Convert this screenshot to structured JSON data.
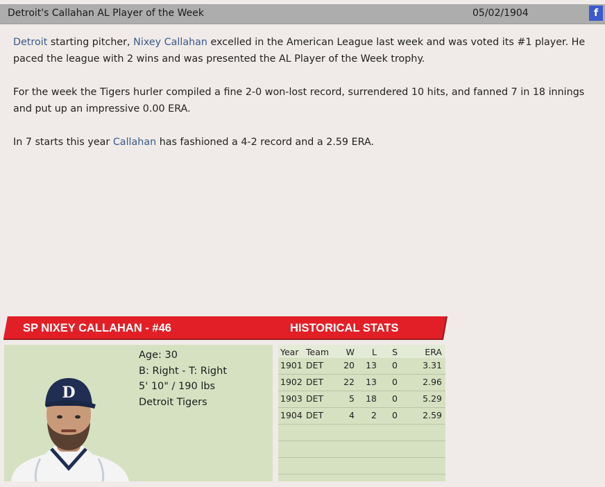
{
  "header": {
    "title": "Detroit's Callahan AL Player of the Week",
    "date": "05/02/1904",
    "share_label": "f"
  },
  "article": {
    "p1": {
      "team": "Detroit",
      "t1": " starting pitcher, ",
      "player": "Nixey Callahan",
      "t2": " excelled in the American League last week and was voted its #1 player. He paced the league with 2 wins and was presented the AL Player of the Week trophy."
    },
    "p2": "For the week the Tigers hurler compiled a fine 2-0 won-lost record, surrendered 10 hits, and fanned 7 in 18 innings and put up an impressive 0.00 ERA.",
    "p3": {
      "t1": "In 7 starts this year ",
      "player": "Callahan",
      "t2": " has fashioned a 4-2 record and a 2.59 ERA."
    }
  },
  "player_card": {
    "banner_left": "SP NIXEY CALLAHAN - #46",
    "banner_right": "HISTORICAL STATS",
    "age": "Age: 30",
    "bats_throws": "B: Right - T: Right",
    "size": "5' 10\" / 190 lbs",
    "team": "Detroit Tigers",
    "cap_logo": "D"
  },
  "stats": {
    "headers": [
      "Year",
      "Team",
      "W",
      "L",
      "S",
      "ERA"
    ],
    "rows": [
      [
        "1901",
        "DET",
        "20",
        "13",
        "0",
        "3.31"
      ],
      [
        "1902",
        "DET",
        "22",
        "13",
        "0",
        "2.96"
      ],
      [
        "1903",
        "DET",
        "5",
        "18",
        "0",
        "5.29"
      ],
      [
        "1904",
        "DET",
        "4",
        "2",
        "0",
        "2.59"
      ]
    ]
  },
  "colors": {
    "title_bar": "#adadad",
    "banner_red": "#e21f26",
    "card_green": "#d6e1c2",
    "link": "#3a5a8c",
    "facebook": "#3b5bcc"
  }
}
